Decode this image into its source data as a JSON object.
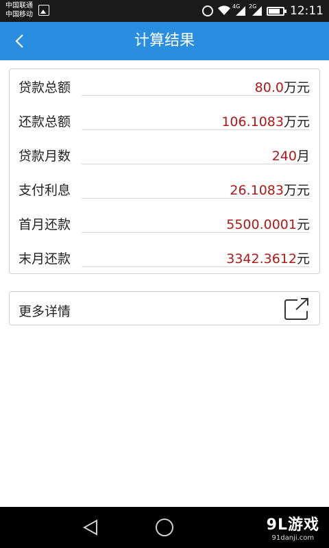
{
  "status_bar": {
    "carrier_1": "中国联通",
    "carrier_2": "中国移动",
    "net_1": "4G",
    "net_2": "2G",
    "time": "12:11"
  },
  "app_bar": {
    "title": "计算结果"
  },
  "results": [
    {
      "label": "贷款总额",
      "value": "80.0",
      "unit": "万元"
    },
    {
      "label": "还款总额",
      "value": "106.1083",
      "unit": "万元"
    },
    {
      "label": "贷款月数",
      "value": "240",
      "unit": "月"
    },
    {
      "label": "支付利息",
      "value": "26.1083",
      "unit": "万元"
    },
    {
      "label": "首月还款",
      "value": "5500.0001",
      "unit": "元"
    },
    {
      "label": "末月还款",
      "value": "3342.3612",
      "unit": "元"
    }
  ],
  "more": {
    "label": "更多详情"
  },
  "watermark": {
    "logo": "9L游戏",
    "url": "91danji.com"
  },
  "colors": {
    "app_bar": "#2a8ee0",
    "value_red": "#b01717"
  }
}
